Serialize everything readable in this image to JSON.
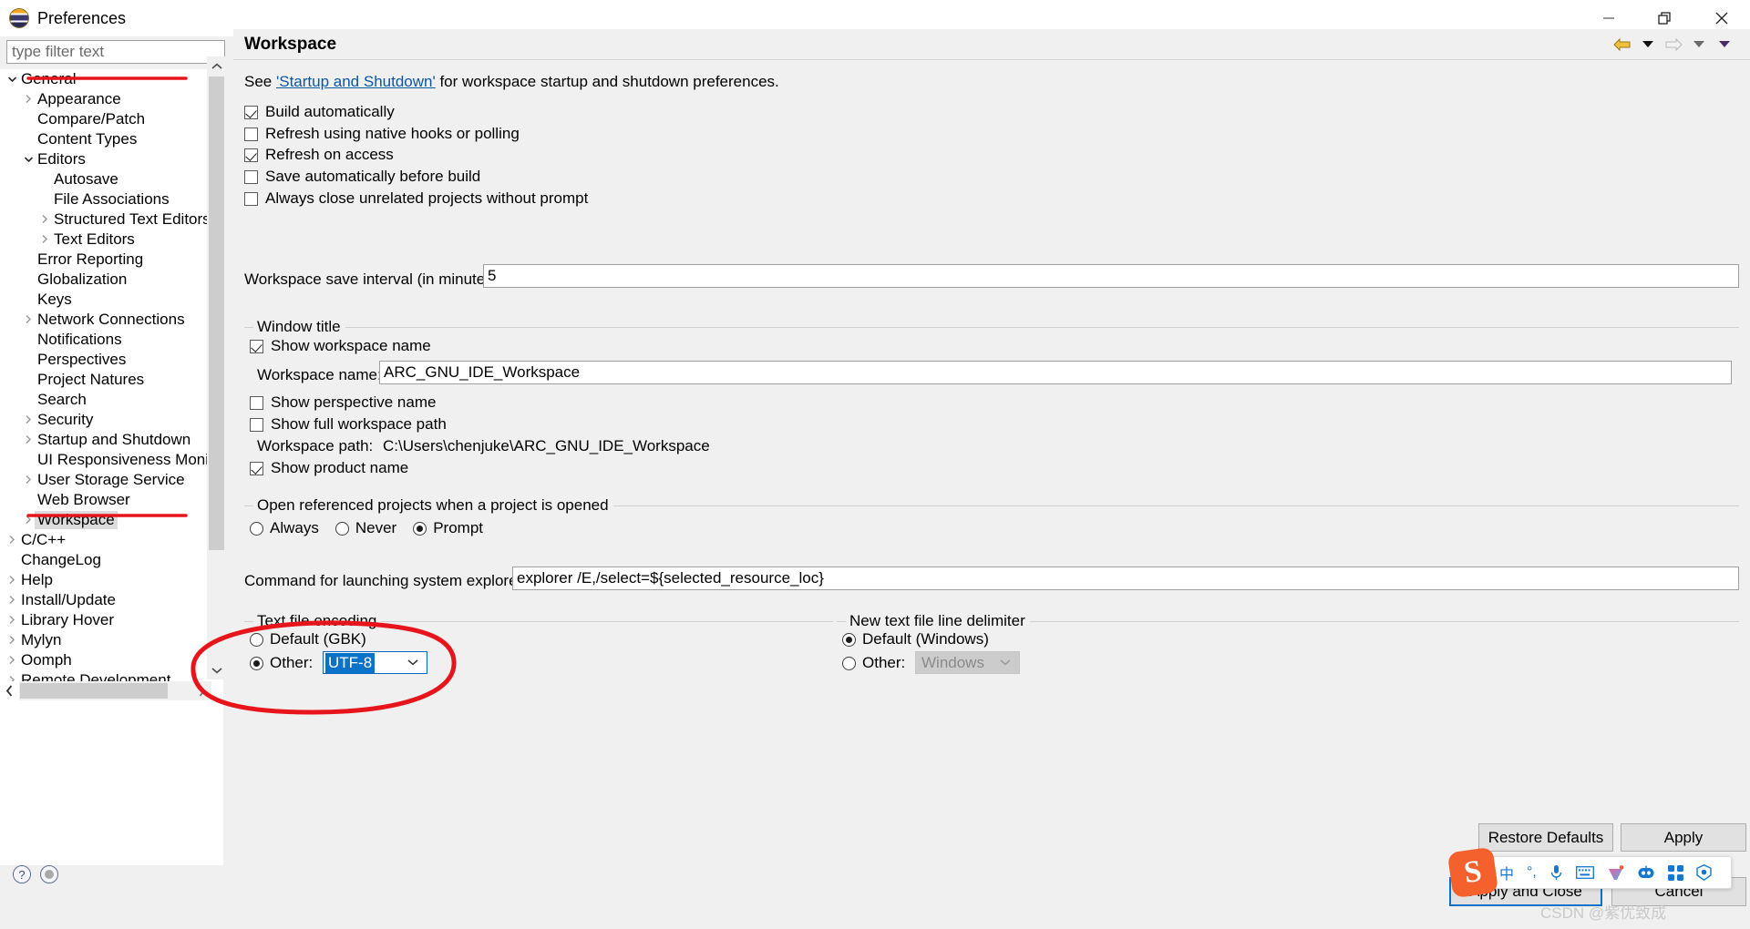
{
  "window": {
    "title": "Preferences",
    "icon": "eclipse-icon",
    "minimize": "minimize-button",
    "restore": "restore-button",
    "close": "close-button"
  },
  "filter": {
    "placeholder": "type filter text",
    "value": ""
  },
  "tree": {
    "items": [
      {
        "label": "General",
        "indent": 0,
        "arrow": "down",
        "selected": false
      },
      {
        "label": "Appearance",
        "indent": 1,
        "arrow": "right",
        "selected": false
      },
      {
        "label": "Compare/Patch",
        "indent": 1,
        "arrow": "none",
        "selected": false
      },
      {
        "label": "Content Types",
        "indent": 1,
        "arrow": "none",
        "selected": false
      },
      {
        "label": "Editors",
        "indent": 1,
        "arrow": "down",
        "selected": false
      },
      {
        "label": "Autosave",
        "indent": 2,
        "arrow": "none",
        "selected": false
      },
      {
        "label": "File Associations",
        "indent": 2,
        "arrow": "none",
        "selected": false
      },
      {
        "label": "Structured Text Editors",
        "indent": 2,
        "arrow": "right",
        "selected": false
      },
      {
        "label": "Text Editors",
        "indent": 2,
        "arrow": "right",
        "selected": false
      },
      {
        "label": "Error Reporting",
        "indent": 1,
        "arrow": "none",
        "selected": false
      },
      {
        "label": "Globalization",
        "indent": 1,
        "arrow": "none",
        "selected": false
      },
      {
        "label": "Keys",
        "indent": 1,
        "arrow": "none",
        "selected": false
      },
      {
        "label": "Network Connections",
        "indent": 1,
        "arrow": "right",
        "selected": false
      },
      {
        "label": "Notifications",
        "indent": 1,
        "arrow": "none",
        "selected": false
      },
      {
        "label": "Perspectives",
        "indent": 1,
        "arrow": "none",
        "selected": false
      },
      {
        "label": "Project Natures",
        "indent": 1,
        "arrow": "none",
        "selected": false
      },
      {
        "label": "Search",
        "indent": 1,
        "arrow": "none",
        "selected": false
      },
      {
        "label": "Security",
        "indent": 1,
        "arrow": "right",
        "selected": false
      },
      {
        "label": "Startup and Shutdown",
        "indent": 1,
        "arrow": "right",
        "selected": false
      },
      {
        "label": "UI Responsiveness Monito",
        "indent": 1,
        "arrow": "none",
        "selected": false
      },
      {
        "label": "User Storage Service",
        "indent": 1,
        "arrow": "right",
        "selected": false
      },
      {
        "label": "Web Browser",
        "indent": 1,
        "arrow": "none",
        "selected": false
      },
      {
        "label": "Workspace",
        "indent": 1,
        "arrow": "right",
        "selected": true
      },
      {
        "label": "C/C++",
        "indent": 0,
        "arrow": "right",
        "selected": false
      },
      {
        "label": "ChangeLog",
        "indent": 0,
        "arrow": "none",
        "selected": false
      },
      {
        "label": "Help",
        "indent": 0,
        "arrow": "right",
        "selected": false
      },
      {
        "label": "Install/Update",
        "indent": 0,
        "arrow": "right",
        "selected": false
      },
      {
        "label": "Library Hover",
        "indent": 0,
        "arrow": "right",
        "selected": false
      },
      {
        "label": "Mylyn",
        "indent": 0,
        "arrow": "right",
        "selected": false
      },
      {
        "label": "Oomph",
        "indent": 0,
        "arrow": "right",
        "selected": false
      },
      {
        "label": "Remote Development",
        "indent": 0,
        "arrow": "right",
        "selected": false
      }
    ]
  },
  "page": {
    "title": "Workspace",
    "nav": {
      "back": "back-arrow-icon",
      "back_menu": "back-dropdown-icon",
      "forward": "forward-arrow-icon",
      "forward_menu": "forward-dropdown-icon",
      "menu": "view-menu-icon"
    },
    "see_prefix": "See ",
    "see_link": "'Startup and Shutdown'",
    "see_suffix": " for workspace startup and shutdown preferences.",
    "checkboxes": [
      {
        "label": "Build automatically",
        "checked": true
      },
      {
        "label": "Refresh using native hooks or polling",
        "checked": false
      },
      {
        "label": "Refresh on access",
        "checked": true
      },
      {
        "label": "Save automatically before build",
        "checked": false
      },
      {
        "label": "Always close unrelated projects without prompt",
        "checked": false
      }
    ],
    "save_interval": {
      "label": "Workspace save interval (in minutes):",
      "value": "5"
    },
    "window_title_group": {
      "title": "Window title",
      "show_workspace_name": {
        "label": "Show workspace name",
        "checked": true
      },
      "workspace_name": {
        "label": "Workspace name:",
        "value": "ARC_GNU_IDE_Workspace"
      },
      "show_perspective_name": {
        "label": "Show perspective name",
        "checked": false
      },
      "show_full_workspace_path": {
        "label": "Show full workspace path",
        "checked": false
      },
      "workspace_path": {
        "label": "Workspace path:",
        "value": "C:\\Users\\chenjuke\\ARC_GNU_IDE_Workspace"
      },
      "show_product_name": {
        "label": "Show product name",
        "checked": true
      }
    },
    "open_referenced_group": {
      "title": "Open referenced projects when a project is opened",
      "options": [
        {
          "label": "Always",
          "selected": false
        },
        {
          "label": "Never",
          "selected": false
        },
        {
          "label": "Prompt",
          "selected": true
        }
      ]
    },
    "command_explorer": {
      "label": "Command for launching system explorer:",
      "value": "explorer /E,/select=${selected_resource_loc}"
    },
    "text_file_encoding": {
      "title": "Text file encoding",
      "default_option": {
        "label": "Default (GBK)",
        "selected": false
      },
      "other_option": {
        "label": "Other:",
        "selected": true
      },
      "other_value": "UTF-8"
    },
    "line_delimiter": {
      "title": "New text file line delimiter",
      "default_option": {
        "label": "Default (Windows)",
        "selected": true
      },
      "other_option": {
        "label": "Other:",
        "selected": false
      },
      "other_value": "Windows"
    }
  },
  "buttons": {
    "restore_defaults": "Restore Defaults",
    "apply": "Apply",
    "apply_and_close": "Apply and Close",
    "cancel": "Cancel"
  },
  "footer": {
    "help_icon": "help-question-icon",
    "status_icon": "status-dot-icon"
  },
  "ime": {
    "logo": "S",
    "items": [
      "中",
      "°,",
      "mic-icon",
      "keyboard-icon",
      "toolbox-icon",
      "robot-icon",
      "apps-icon",
      "settings-icon"
    ]
  },
  "watermark": "CSDN @紫优致成",
  "colors": {
    "annotation": "#e8141c",
    "link": "#0b57a4",
    "selection": "#0a72c8",
    "panel": "#f0f0f0"
  }
}
